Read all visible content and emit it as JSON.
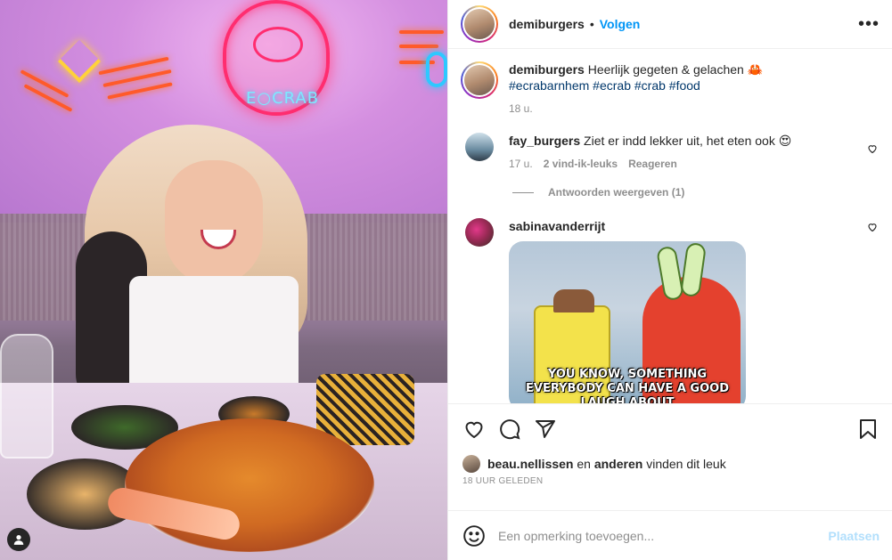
{
  "post": {
    "username": "demiburgers",
    "follow_label": "Volgen",
    "separator": "•",
    "more_label": "•••"
  },
  "photo": {
    "sign_text": "E○CRAB"
  },
  "caption": {
    "username": "demiburgers",
    "text": "Heerlijk gegeten & gelachen 🦀",
    "hashtags": [
      "#ecrabarnhem",
      "#ecrab",
      "#crab",
      "#food"
    ],
    "time": "18 u."
  },
  "comments": [
    {
      "username": "fay_burgers",
      "text": "Ziet er indd lekker uit, het eten ook 😍",
      "time": "17 u.",
      "likes": "2 vind-ik-leuks",
      "reply_label": "Reageren",
      "view_replies": "Antwoorden weergeven (1)"
    },
    {
      "username": "sabinavanderrijt",
      "gif_caption": "YOU KNOW, SOMETHING EVERYBODY CAN HAVE A GOOD LAUGH ABOUT"
    }
  ],
  "likes": {
    "first_user": "beau.nellissen",
    "connector": "en",
    "others": "anderen",
    "suffix": "vinden dit leuk"
  },
  "posted_ago": "18 UUR GELEDEN",
  "composer": {
    "placeholder": "Een opmerking toevoegen...",
    "post_label": "Plaatsen"
  },
  "icons": [
    "heart-icon",
    "comment-icon",
    "share-icon",
    "bookmark-icon",
    "emoji-icon",
    "more-icon",
    "user-tag-icon"
  ],
  "colors": {
    "link_blue": "#0095f6",
    "hashtag_blue": "#00376b",
    "muted": "#8e8e8e",
    "post_disabled": "#b2dffc"
  }
}
